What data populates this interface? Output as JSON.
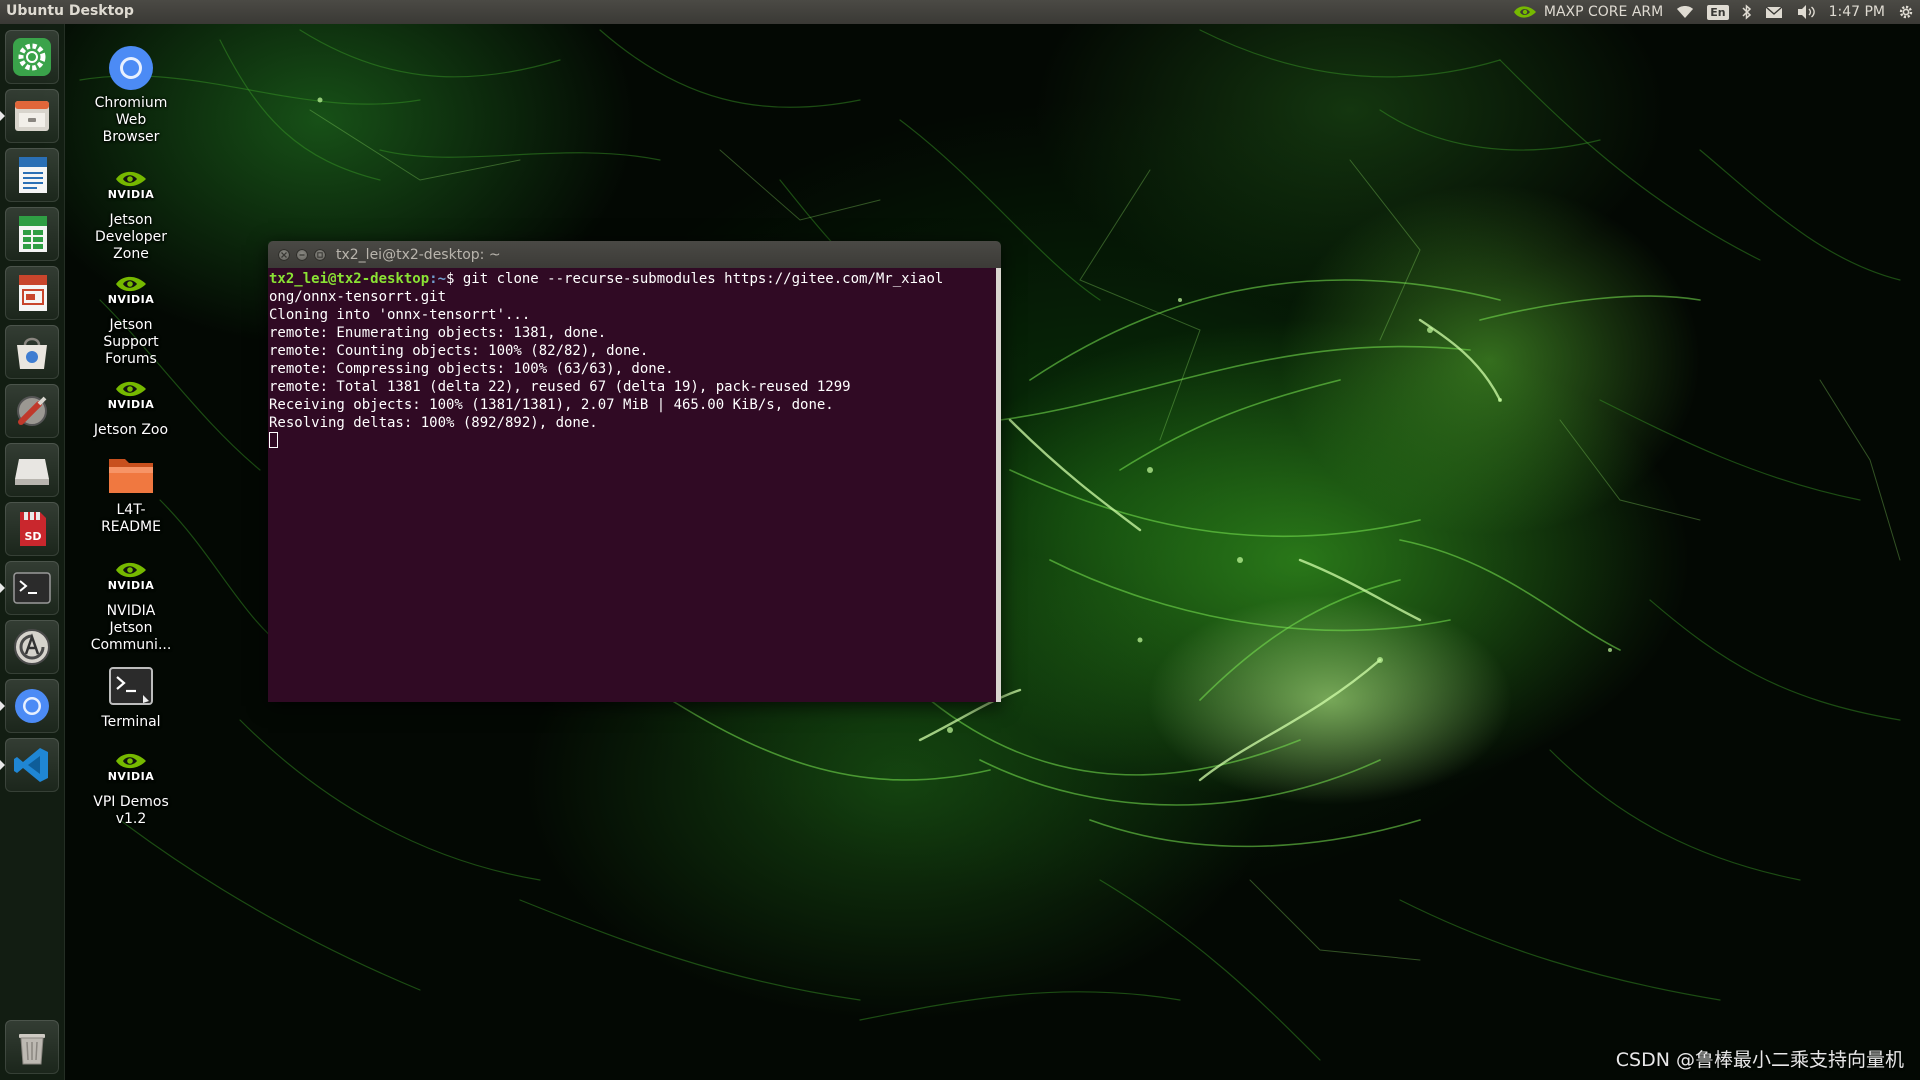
{
  "top_panel": {
    "title": "Ubuntu Desktop",
    "power_mode": "MAXP CORE ARM",
    "keyboard_layout": "En",
    "clock": "1:47 PM"
  },
  "launcher": {
    "items": [
      {
        "name": "system-settings-icon",
        "running": false
      },
      {
        "name": "file-manager-icon",
        "running": true
      },
      {
        "name": "libreoffice-writer-icon",
        "running": false
      },
      {
        "name": "libreoffice-calc-icon",
        "running": false
      },
      {
        "name": "libreoffice-impress-icon",
        "running": false
      },
      {
        "name": "software-center-icon",
        "running": false
      },
      {
        "name": "system-tools-icon",
        "running": false
      },
      {
        "name": "disk-drive-icon",
        "running": false
      },
      {
        "name": "sd-card-icon",
        "running": false
      },
      {
        "name": "terminal-icon",
        "running": true
      },
      {
        "name": "software-updater-icon",
        "running": false
      },
      {
        "name": "chromium-icon",
        "running": true
      },
      {
        "name": "vscode-icon",
        "running": true
      },
      {
        "name": "trash-icon",
        "running": false
      }
    ]
  },
  "desktop_icons": {
    "chromium": {
      "line1": "Chromium",
      "line2": "Web",
      "line3": "Browser"
    },
    "devzone": {
      "brand": "NVIDIA",
      "line1": "Jetson",
      "line2": "Developer",
      "line3": "Zone"
    },
    "forums": {
      "brand": "NVIDIA",
      "line1": "Jetson",
      "line2": "Support",
      "line3": "Forums"
    },
    "zoo": {
      "brand": "NVIDIA",
      "line1": "Jetson Zoo"
    },
    "readme": {
      "line1": "L4T-",
      "line2": "README"
    },
    "community": {
      "brand": "NVIDIA",
      "line1": "NVIDIA",
      "line2": "Jetson",
      "line3": "Communi..."
    },
    "terminal": {
      "line1": "Terminal"
    },
    "vpi": {
      "brand": "NVIDIA",
      "line1": "VPI Demos",
      "line2": "v1.2"
    }
  },
  "terminal": {
    "title": "tx2_lei@tx2-desktop: ~",
    "prompt_user": "tx2_lei@tx2-desktop",
    "prompt_path": ":~",
    "prompt_symbol": "$ ",
    "command_line1": "git clone --recurse-submodules https://gitee.com/Mr_xiaol",
    "command_line2": "ong/onnx-tensorrt.git",
    "output": [
      "Cloning into 'onnx-tensorrt'...",
      "remote: Enumerating objects: 1381, done.",
      "remote: Counting objects: 100% (82/82), done.",
      "remote: Compressing objects: 100% (63/63), done.",
      "remote: Total 1381 (delta 22), reused 67 (delta 19), pack-reused 1299",
      "Receiving objects: 100% (1381/1381), 2.07 MiB | 465.00 KiB/s, done.",
      "Resolving deltas: 100% (892/892), done."
    ]
  },
  "watermark": "CSDN @鲁棒最小二乘支持向量机",
  "colors": {
    "terminal_bg": "#300a24",
    "prompt_user": "#8ae234",
    "prompt_path": "#729fcf",
    "panel_bg": "#3c3b37",
    "nvidia_green": "#76b900"
  }
}
